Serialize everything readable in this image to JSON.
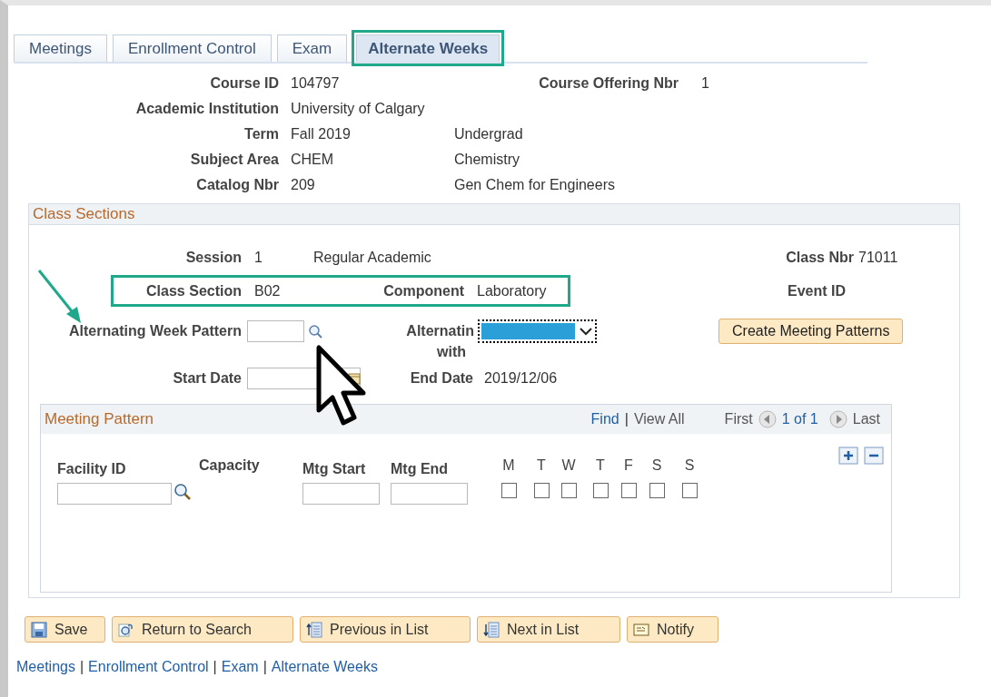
{
  "tabs": [
    {
      "label": "Meetings",
      "selected": false
    },
    {
      "label": "Enrollment Control",
      "selected": false
    },
    {
      "label": "Exam",
      "selected": false
    },
    {
      "label": "Alternate Weeks",
      "selected": true
    }
  ],
  "course": [
    {
      "label": "Course ID",
      "value": "104797",
      "side_label": "Course Offering Nbr",
      "side_value": "1"
    },
    {
      "label": "Academic Institution",
      "value": "University of Calgary"
    },
    {
      "label": "Term",
      "value": "Fall 2019",
      "note": "Undergrad"
    },
    {
      "label": "Subject Area",
      "value": "CHEM",
      "note": "Chemistry"
    },
    {
      "label": "Catalog Nbr",
      "value": "209",
      "note": "Gen Chem for Engineers"
    }
  ],
  "class_sections": {
    "title": "Class Sections",
    "session": {
      "label": "Session",
      "value": "1",
      "description": "Regular Academic"
    },
    "class_nbr": {
      "label": "Class Nbr",
      "value": "71011"
    },
    "class_section": {
      "label": "Class Section",
      "value": "B02"
    },
    "component": {
      "label": "Component",
      "value": "Laboratory"
    },
    "event_id": {
      "label": "Event ID"
    },
    "alternating_week_pattern": {
      "label": "Alternating Week Pattern"
    },
    "alternating_with": {
      "label_line_1": "Alternatin",
      "label_line_2": "with",
      "focused": true
    },
    "create_button": "Create Meeting Patterns",
    "start_date": {
      "label": "Start Date"
    },
    "end_date": {
      "label": "End Date",
      "value": "2019/12/06"
    },
    "meeting_pattern": {
      "title": "Meeting Pattern",
      "find": "Find",
      "separator": "|",
      "view_all": "View All",
      "first": "First",
      "count": "1 of 1",
      "last": "Last",
      "facility_id": "Facility ID",
      "capacity": "Capacity",
      "mtg_start": "Mtg Start",
      "mtg_end": "Mtg End",
      "days": [
        {
          "label": "M",
          "checked": false
        },
        {
          "label": "T",
          "checked": false
        },
        {
          "label": "W",
          "checked": false
        },
        {
          "label": "T",
          "checked": false
        },
        {
          "label": "F",
          "checked": false
        },
        {
          "label": "S",
          "checked": false
        },
        {
          "label": "S",
          "checked": false
        }
      ]
    }
  },
  "buttons": [
    {
      "label": "Save",
      "kind": "save"
    },
    {
      "label": "Return to Search",
      "kind": "return"
    },
    {
      "label": "Previous in List",
      "kind": "previous"
    },
    {
      "label": "Next in List",
      "kind": "next"
    },
    {
      "label": "Notify",
      "kind": "notify"
    }
  ],
  "footer": {
    "links": [
      "Meetings",
      "Enrollment Control",
      "Exam",
      "Alternate Weeks"
    ],
    "separators": [
      "|",
      "|",
      "|"
    ]
  }
}
